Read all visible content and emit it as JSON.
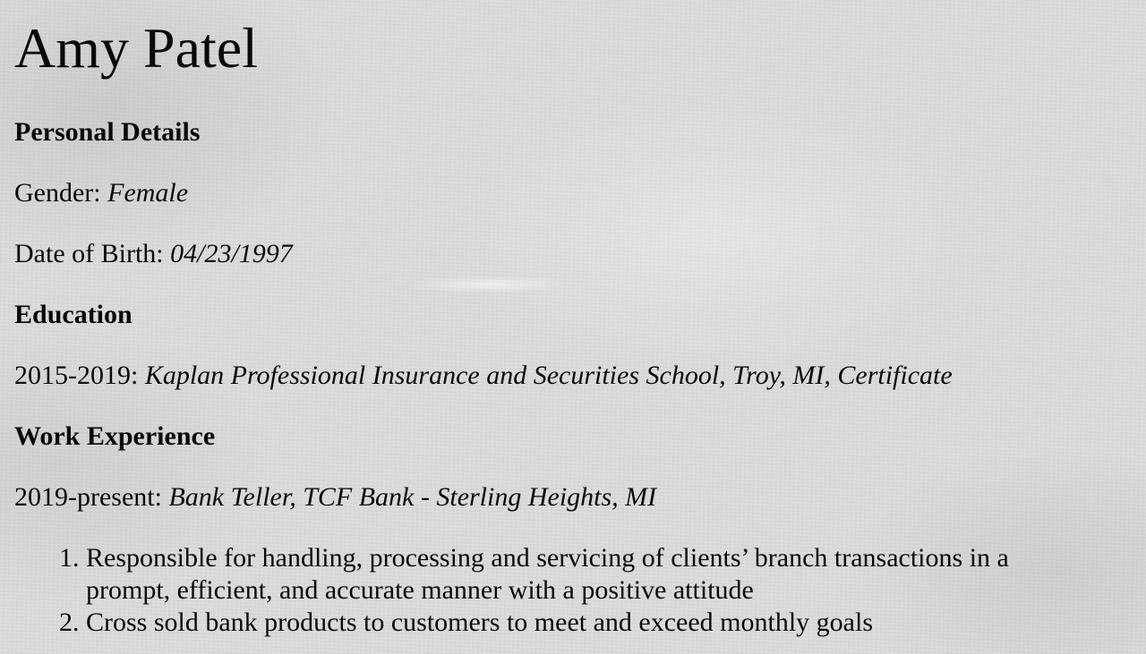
{
  "name": "Amy Patel",
  "personal": {
    "heading": "Personal Details",
    "gender_label": "Gender:",
    "gender_value": "Female",
    "dob_label": "Date of Birth:",
    "dob_value": "04/23/1997"
  },
  "education": {
    "heading": "Education",
    "entries": [
      {
        "years": "2015-2019:",
        "detail": "Kaplan Professional Insurance and Securities School, Troy, MI, Certificate"
      }
    ]
  },
  "work": {
    "heading": "Work Experience",
    "entries": [
      {
        "years": "2019-present:",
        "position": "Bank Teller, TCF Bank",
        "separator": "-",
        "location": "Sterling Heights, MI",
        "duties": [
          "Responsible for handling, processing and servicing of clients’ branch transactions in a prompt, efficient, and accurate manner with a positive attitude",
          "Cross sold bank products to customers to meet and exceed monthly goals"
        ]
      }
    ]
  },
  "colors": {
    "text": "#0a0a0a",
    "paper": "#dcdcdc"
  }
}
